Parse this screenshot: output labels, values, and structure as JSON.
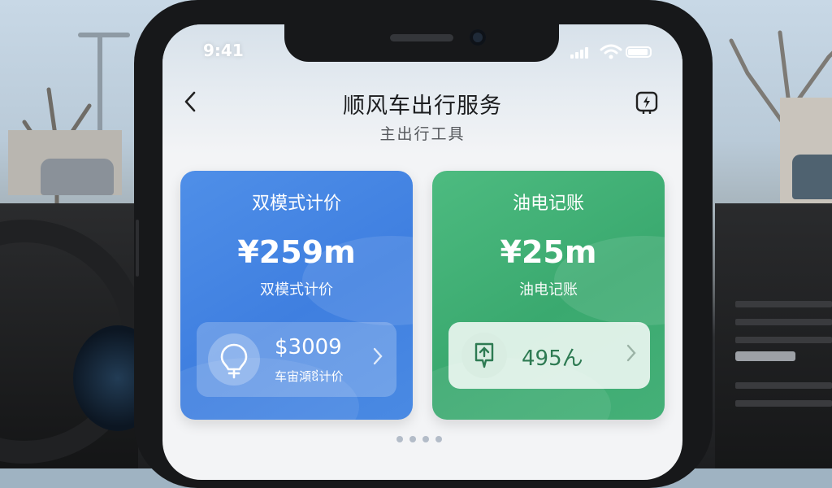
{
  "status_bar": {
    "time": "9:41"
  },
  "header": {
    "title": "顺风车出行服务",
    "subtitle": "主出行工具",
    "back_icon": "chevron-left-icon",
    "action_icon": "charging-station-icon"
  },
  "cards": [
    {
      "title": "双模式计价",
      "value": "¥259m",
      "subtitle": "双模式计价",
      "color": "#4286e4",
      "inner": {
        "icon": "lightbulb-icon",
        "value": "$3009",
        "label": "车宙澒ឪ计价"
      }
    },
    {
      "title": "油电记账",
      "value": "¥25m",
      "subtitle": "油电记账",
      "color": "#3fae72",
      "inner": {
        "icon": "fuel-charge-icon",
        "value": "495ん"
      }
    }
  ],
  "pagination": {
    "count": 4
  },
  "colors": {
    "accent_blue": "#4286e4",
    "accent_green": "#3fae72",
    "ink": "#1c1d1f"
  }
}
